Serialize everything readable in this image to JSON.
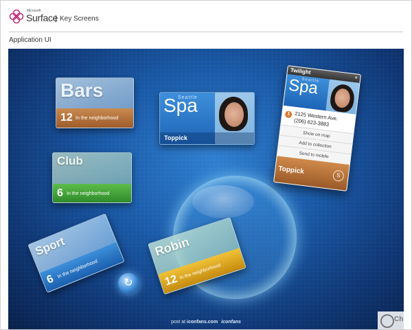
{
  "header": {
    "brand_small": "Microsoft",
    "brand_name": "Surface",
    "separator": "|",
    "subtitle": "Key Screens"
  },
  "section": {
    "label": "Application UI"
  },
  "tiles": {
    "bars": {
      "title": "Bars",
      "count": "12",
      "caption": "In the neighborhood",
      "color": "#b9733b"
    },
    "club": {
      "title": "Club",
      "count": "6",
      "caption": "In the neighborhood",
      "color": "#47a63a"
    },
    "sport": {
      "title": "Sport",
      "count": "6",
      "caption": "In the neighborhood",
      "color": "#2d7dcc"
    },
    "robin": {
      "title": "Robin",
      "count": "12",
      "caption": "In the neighborhood",
      "color": "#e0a823"
    },
    "spa": {
      "city": "Seattle",
      "title": "Spa",
      "brand": "Toppick"
    }
  },
  "detail_card": {
    "venue": "Twilight",
    "close_icon": "close-icon",
    "city": "Seattle",
    "title": "Spa",
    "pin": "1",
    "address_line1": "2125 Western Ave.",
    "address_line2": "(206) 623-3883",
    "actions": [
      "Show on map",
      "Add to collection",
      "Send to mobile"
    ],
    "brand": "Toppick",
    "brand_logo": "S"
  },
  "controls": {
    "refresh_icon": "refresh-icon",
    "refresh_glyph": "↻"
  },
  "footer": {
    "credit_prefix": "post at",
    "credit_domain": "iconfans.com",
    "credit_mark": "iconfans",
    "corner_mark": "Ch"
  },
  "colors": {
    "stage_center": "#2f7fd0",
    "stage_edge": "#08204a",
    "accent_orange": "#d08a4b"
  }
}
